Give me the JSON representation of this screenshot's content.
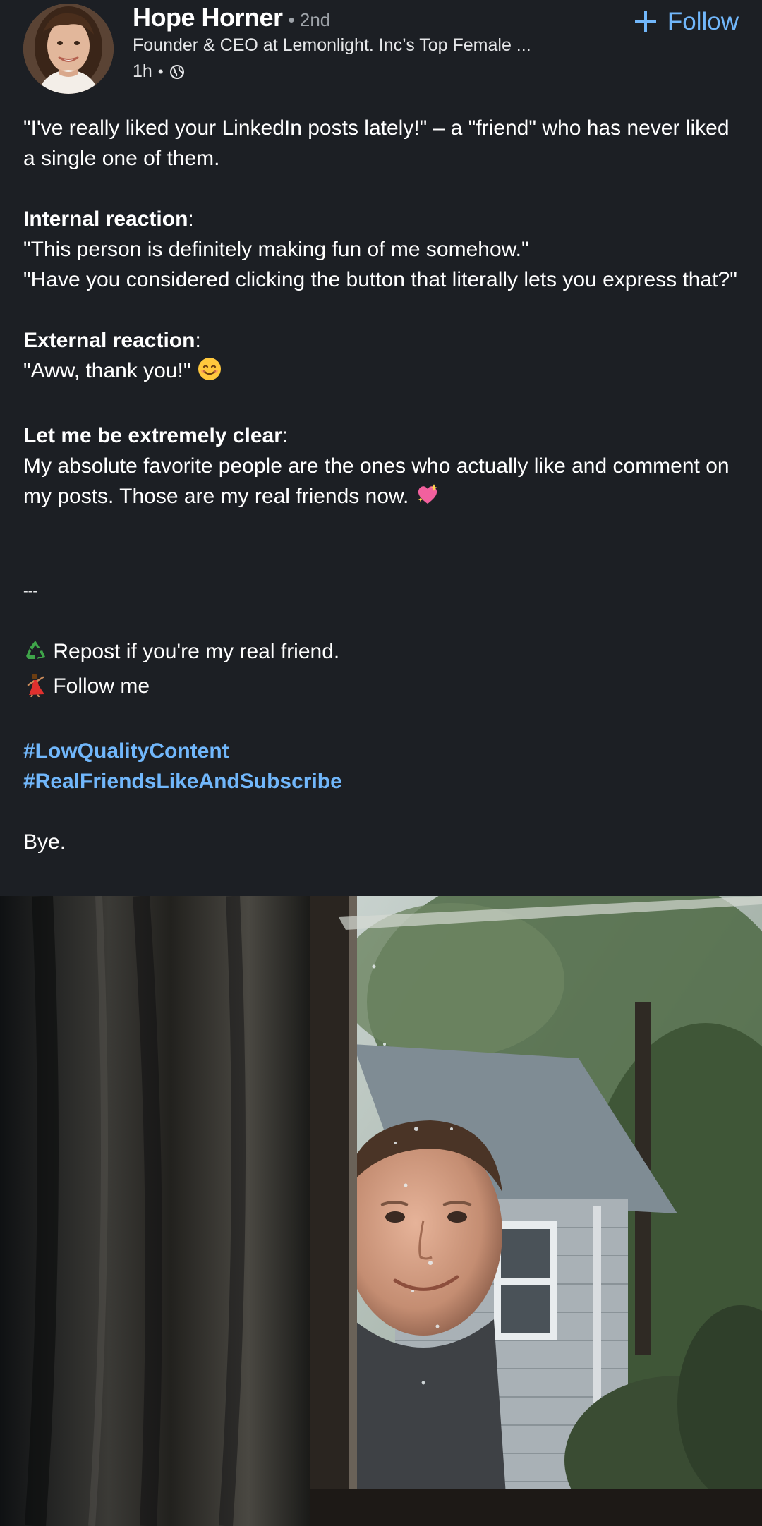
{
  "author": {
    "name": "Hope Horner",
    "degree": "• 2nd",
    "headline": "Founder & CEO at Lemonlight. Inc’s Top Female ...",
    "time": "1h",
    "visibility_icon": "globe-icon"
  },
  "follow": {
    "label": "Follow",
    "icon": "plus-icon"
  },
  "post": {
    "intro_line": "\"I've really liked your LinkedIn posts lately!\" –  a \"friend\" who has never liked a single one of them.",
    "internal_heading": "Internal reaction",
    "internal_line1": "\"This person is definitely making fun of me somehow.\"",
    "internal_line2": "\"Have you considered clicking the button that literally lets you express that?\"",
    "external_heading": "External reaction",
    "external_line": "\"Aww, thank you!\"",
    "external_emoji": "smiling-face-emoji",
    "clear_heading": "Let me be extremely clear",
    "clear_line": "My absolute favorite people are the ones who actually like and comment on my posts. Those are my real friends now.",
    "clear_emoji": "sparkling-heart-emoji",
    "colon": ":",
    "divider": "---",
    "repost_line": "Repost if you're my real friend.",
    "repost_emoji": "recycle-emoji",
    "follow_line": "Follow me",
    "follow_emoji": "dancer-emoji",
    "hashtags": [
      "#LowQualityContent",
      "#RealFriendsLikeAndSubscribe"
    ],
    "closing": "Bye."
  },
  "colors": {
    "background": "#1c1f24",
    "link": "#71b7fb",
    "secondary_text": "#9ea3a9"
  }
}
